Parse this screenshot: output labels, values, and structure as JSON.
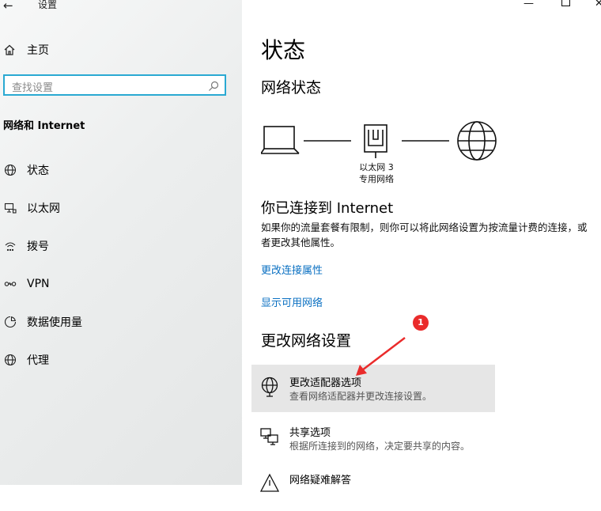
{
  "window": {
    "title": "设置",
    "back_icon": "back-arrow-icon",
    "controls": [
      "minimize-icon",
      "maximize-icon",
      "close-icon"
    ]
  },
  "sidebar": {
    "home_label": "主页",
    "search_placeholder": "查找设置",
    "section_title": "网络和 Internet",
    "items": [
      {
        "label": "状态",
        "icon": "globe-icon"
      },
      {
        "label": "以太网",
        "icon": "ethernet-icon"
      },
      {
        "label": "拨号",
        "icon": "dialup-icon"
      },
      {
        "label": "VPN",
        "icon": "vpn-icon"
      },
      {
        "label": "数据使用量",
        "icon": "data-usage-icon"
      },
      {
        "label": "代理",
        "icon": "proxy-globe-icon"
      }
    ]
  },
  "main": {
    "page_title": "状态",
    "network_status_title": "网络状态",
    "adapter_name": "以太网 3",
    "adapter_type": "专用网络",
    "connected_title": "你已连接到 Internet",
    "connected_desc": "如果你的流量套餐有限制，则你可以将此网络设置为按流量计费的连接，或者更改其他属性。",
    "link_properties": "更改连接属性",
    "link_available": "显示可用网络",
    "change_settings_title": "更改网络设置",
    "options": [
      {
        "title": "更改适配器选项",
        "desc": "查看网络适配器并更改连接设置。",
        "icon": "adapter-globe-icon"
      },
      {
        "title": "共享选项",
        "desc": "根据所连接到的网络，决定要共享的内容。",
        "icon": "sharing-icon"
      },
      {
        "title": "网络疑难解答",
        "desc": "",
        "icon": "warning-icon"
      }
    ],
    "annotation_badge": "1",
    "accent_color": "#0a70c2",
    "badge_color": "#ea2b2b"
  }
}
